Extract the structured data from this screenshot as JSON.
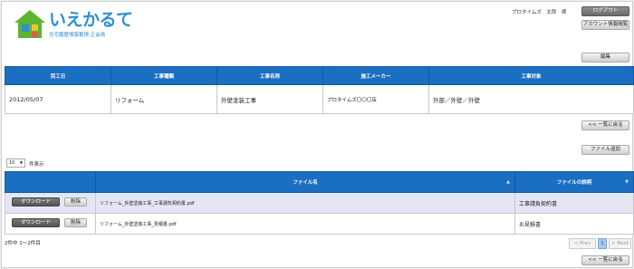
{
  "header": {
    "logo_text": "いえかるて",
    "logo_subtext": "住宅履歴情報蓄積 正会員",
    "user_name": "プロタイムズ　太郎　様",
    "logout_label": "ログアウト",
    "account_label": "アカウント情報閲覧"
  },
  "info": {
    "edit_label": "編集",
    "columns": [
      "完工日",
      "工事種類",
      "工事名称",
      "施工メーカー",
      "工事対象"
    ],
    "row": [
      "2012/05/07",
      "リフォーム",
      "外壁塗装工事",
      "プロタイムズ〇〇〇店",
      "外部／外壁／外壁"
    ],
    "back_label": "<< 一覧に戻る"
  },
  "files": {
    "add_label": "ファイル追加",
    "page_length": "10",
    "page_length_label": "件表示",
    "columns": [
      "",
      "ファイル名",
      "ファイルの説明"
    ],
    "download_label": "ダウンロード",
    "delete_label": "削除",
    "rows": [
      {
        "name": "リフォーム_外壁塗装工事_工事請負契約書.pdf",
        "description": "工事請負契約書"
      },
      {
        "name": "リフォーム_外壁塗装工事_見積書.pdf",
        "description": "お見積書"
      }
    ],
    "count_text": "2件中 1〜2件目",
    "prev_label": "< Prev",
    "current_page": "1",
    "next_label": "> Next",
    "back_label": "<< 一覧に戻る"
  },
  "colors": {
    "header_blue": "#1b6fc2",
    "row_tint": "#e4e6f6",
    "logo_blue": "#2f8fd3",
    "logo_green": "#5cb531"
  }
}
